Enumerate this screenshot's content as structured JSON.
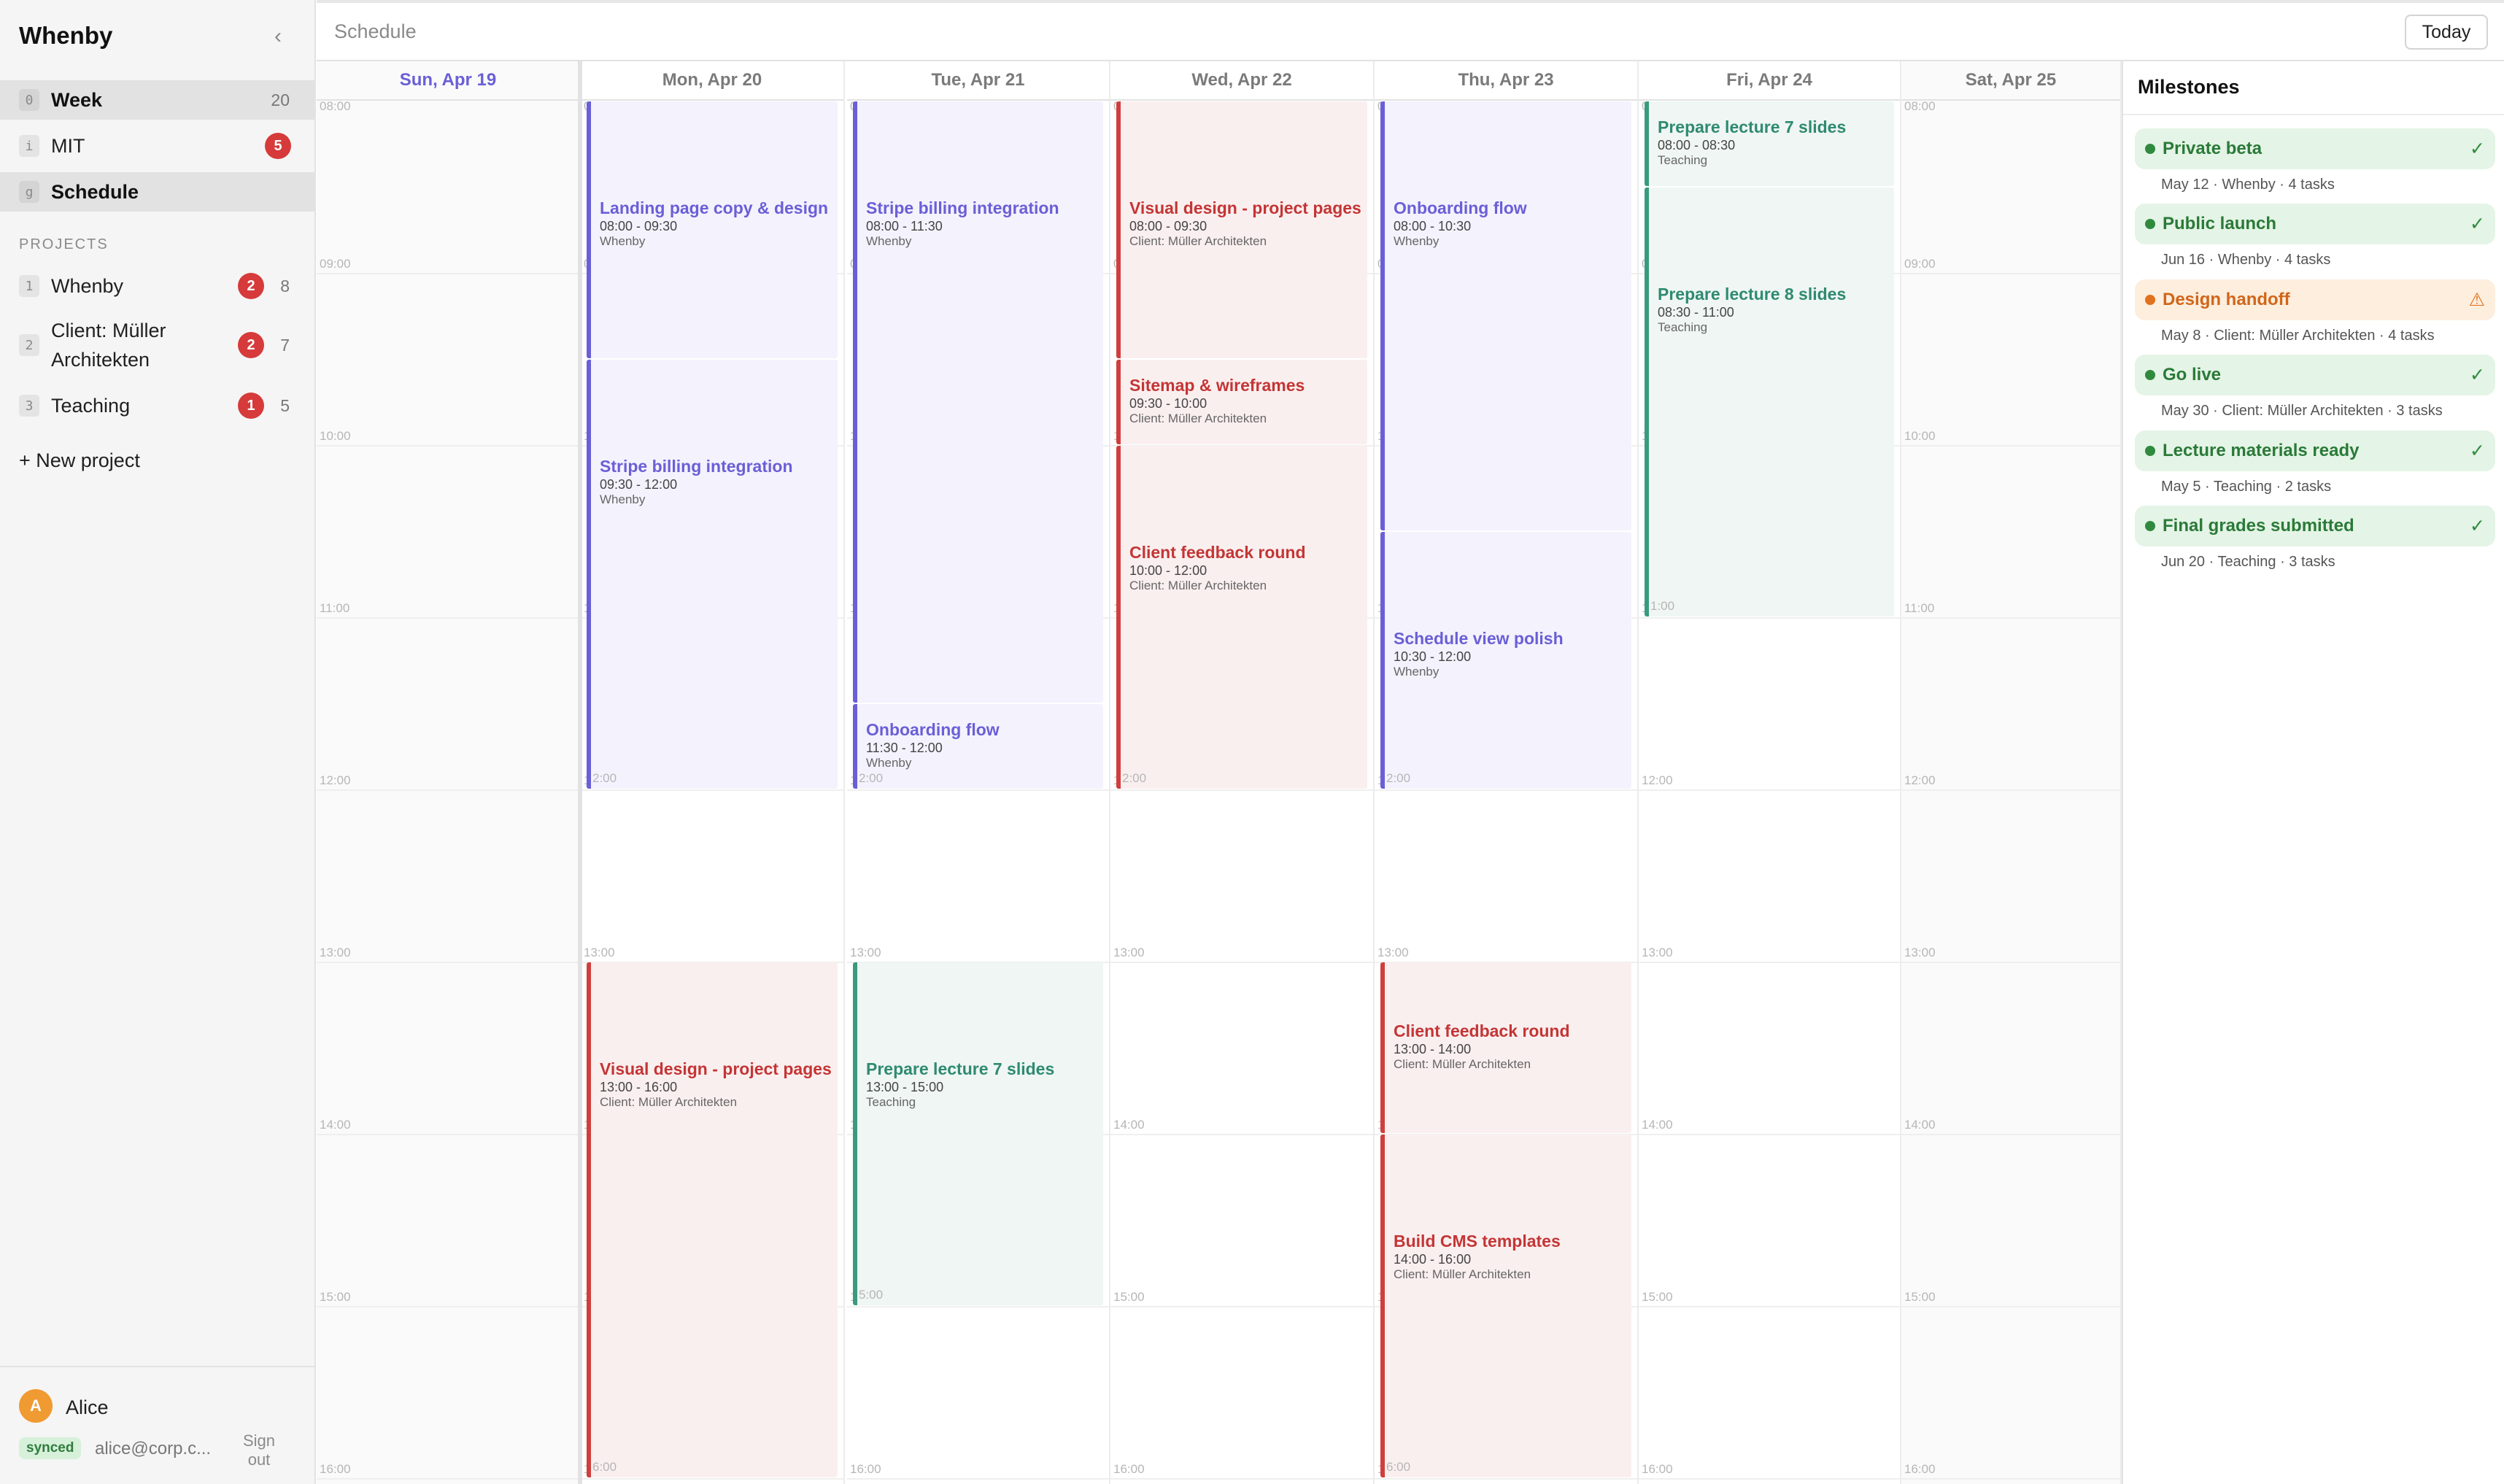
{
  "sidebar": {
    "app_title": "Whenby",
    "collapse_icon": "chevron-left-icon",
    "nav": [
      {
        "key": "0",
        "label": "Week",
        "count": "20",
        "active": true
      },
      {
        "key": "i",
        "label": "MIT",
        "badge": "5"
      },
      {
        "key": "g",
        "label": "Schedule",
        "active": true
      }
    ],
    "projects_heading": "PROJECTS",
    "projects": [
      {
        "key": "1",
        "label": "Whenby",
        "badge": "2",
        "count": "8"
      },
      {
        "key": "2",
        "label_line1": "Client: Müller",
        "label_line2": "Architekten",
        "badge": "2",
        "count": "7"
      },
      {
        "key": "3",
        "label": "Teaching",
        "badge": "1",
        "count": "5"
      }
    ],
    "new_project": "+ New project",
    "user": {
      "initial": "A",
      "name": "Alice",
      "sync_status": "synced",
      "email": "alice@corp.c...",
      "signout_line1": "Sign",
      "signout_line2": "out"
    }
  },
  "topbar": {
    "title": "Schedule",
    "today_button": "Today"
  },
  "calendar": {
    "days": [
      {
        "label": "Sun, Apr 19",
        "today": true
      },
      {
        "label": "Mon, Apr 20"
      },
      {
        "label": "Tue, Apr 21"
      },
      {
        "label": "Wed, Apr 22"
      },
      {
        "label": "Thu, Apr 23"
      },
      {
        "label": "Fri, Apr 24"
      },
      {
        "label": "Sat, Apr 25"
      }
    ],
    "hours": [
      "08:00",
      "09:00",
      "10:00",
      "11:00",
      "12:00",
      "13:00",
      "14:00",
      "15:00",
      "16:00"
    ],
    "events": [
      {
        "day": 1,
        "start": "08:00",
        "end": "09:30",
        "title": "Landing page copy & design",
        "time": "08:00 - 09:30",
        "project": "Whenby",
        "color": "purple"
      },
      {
        "day": 1,
        "start": "09:30",
        "end": "12:00",
        "title": "Stripe billing integration",
        "time": "09:30 - 12:00",
        "project": "Whenby",
        "color": "purple",
        "end_label": "2:00"
      },
      {
        "day": 1,
        "start": "13:00",
        "end": "16:00",
        "title": "Visual design - project pages",
        "time": "13:00 - 16:00",
        "project": "Client: Müller Architekten",
        "color": "red",
        "end_label": "6:00"
      },
      {
        "day": 2,
        "start": "08:00",
        "end": "11:30",
        "title": "Stripe billing integration",
        "time": "08:00 - 11:30",
        "project": "Whenby",
        "color": "purple"
      },
      {
        "day": 2,
        "start": "11:30",
        "end": "12:00",
        "title": "Onboarding flow",
        "time": "11:30 - 12:00",
        "project": "Whenby",
        "color": "purple",
        "end_label": "2:00"
      },
      {
        "day": 2,
        "start": "13:00",
        "end": "15:00",
        "title": "Prepare lecture 7 slides",
        "time": "13:00 - 15:00",
        "project": "Teaching",
        "color": "teal",
        "end_label": "5:00"
      },
      {
        "day": 3,
        "start": "08:00",
        "end": "09:30",
        "title": "Visual design - project pages",
        "time": "08:00 - 09:30",
        "project": "Client: Müller Architekten",
        "color": "red"
      },
      {
        "day": 3,
        "start": "09:30",
        "end": "10:00",
        "title": "Sitemap & wireframes",
        "time": "09:30 - 10:00",
        "project": "Client: Müller Architekten",
        "color": "red"
      },
      {
        "day": 3,
        "start": "10:00",
        "end": "12:00",
        "title": "Client feedback round",
        "time": "10:00 - 12:00",
        "project": "Client: Müller Architekten",
        "color": "red",
        "end_label": "2:00"
      },
      {
        "day": 4,
        "start": "08:00",
        "end": "10:30",
        "title": "Onboarding flow",
        "time": "08:00 - 10:30",
        "project": "Whenby",
        "color": "purple"
      },
      {
        "day": 4,
        "start": "10:30",
        "end": "12:00",
        "title": "Schedule view polish",
        "time": "10:30 - 12:00",
        "project": "Whenby",
        "color": "purple",
        "end_label": "2:00"
      },
      {
        "day": 4,
        "start": "13:00",
        "end": "14:00",
        "title": "Client feedback round",
        "time": "13:00 - 14:00",
        "project": "Client: Müller Architekten",
        "color": "red"
      },
      {
        "day": 4,
        "start": "14:00",
        "end": "16:00",
        "title": "Build CMS templates",
        "time": "14:00 - 16:00",
        "project": "Client: Müller Architekten",
        "color": "red",
        "end_label": "6:00"
      },
      {
        "day": 5,
        "start": "08:00",
        "end": "08:30",
        "title": "Prepare lecture 7 slides",
        "time": "08:00 - 08:30",
        "project": "Teaching",
        "color": "teal"
      },
      {
        "day": 5,
        "start": "08:30",
        "end": "11:00",
        "title": "Prepare lecture 8 slides",
        "time": "08:30 - 11:00",
        "project": "Teaching",
        "color": "teal",
        "end_label": "1:00"
      }
    ]
  },
  "milestones": {
    "title": "Milestones",
    "items": [
      {
        "name": "Private beta",
        "meta": "May 12 · Whenby · 4 tasks",
        "status": "done",
        "icon": "check-icon"
      },
      {
        "name": "Public launch",
        "meta": "Jun 16 · Whenby · 4 tasks",
        "status": "done",
        "icon": "check-icon"
      },
      {
        "name": "Design handoff",
        "meta": "May 8 · Client: Müller Architekten · 4 tasks",
        "status": "warn",
        "icon": "warning-icon"
      },
      {
        "name": "Go live",
        "meta": "May 30 · Client: Müller Architekten · 3 tasks",
        "status": "done",
        "icon": "check-icon"
      },
      {
        "name": "Lecture materials ready",
        "meta": "May 5 · Teaching · 2 tasks",
        "status": "done",
        "icon": "check-icon"
      },
      {
        "name": "Final grades submitted",
        "meta": "Jun 20 · Teaching · 3 tasks",
        "status": "done",
        "icon": "check-icon"
      }
    ],
    "colors": {
      "done": "#2f8a3e",
      "warn": "#e2711d"
    }
  },
  "colors": {
    "whenby": "#6a5fd6",
    "client": "#d03e3e",
    "teaching": "#3a9a7e",
    "badge": "#d63a3a",
    "avatar": "#f09a32"
  }
}
